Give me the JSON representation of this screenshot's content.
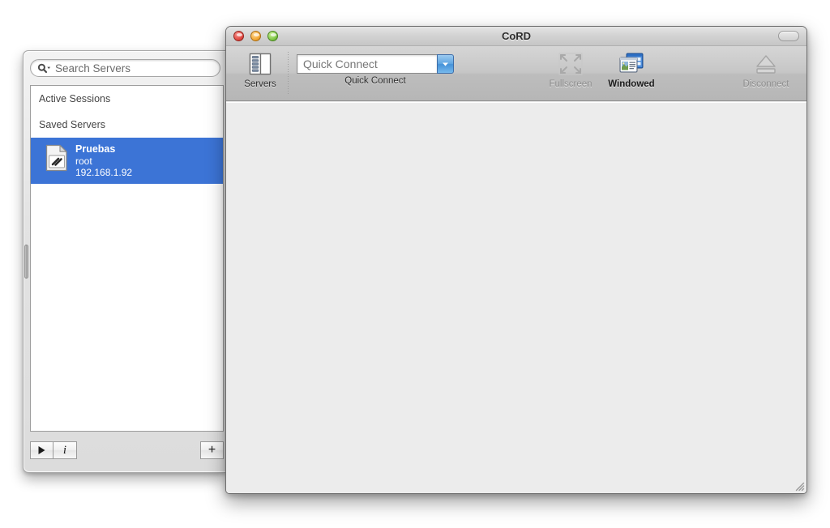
{
  "window": {
    "title": "CoRD",
    "traffic_lights": [
      "close",
      "minimize",
      "zoom"
    ],
    "toolbar_toggle_name": "toolbar-toggle-button"
  },
  "toolbar": {
    "servers": {
      "label": "Servers",
      "icon": "servers-drawer-icon",
      "enabled": true
    },
    "quick_connect": {
      "label": "Quick Connect",
      "placeholder": "Quick Connect",
      "value": "",
      "dropdown_icon": "chevron-down-icon"
    },
    "fullscreen": {
      "label": "Fullscreen",
      "icon": "fullscreen-arrows-icon",
      "enabled": false
    },
    "windowed": {
      "label": "Windowed",
      "icon": "windowed-stack-icon",
      "enabled": true,
      "selected": true
    },
    "disconnect": {
      "label": "Disconnect",
      "icon": "eject-icon",
      "enabled": false
    }
  },
  "drawer": {
    "search": {
      "placeholder": "Search Servers",
      "value": "",
      "icon": "search-icon"
    },
    "groups": [
      {
        "label": "Active Sessions",
        "items": []
      },
      {
        "label": "Saved Servers",
        "items": [
          {
            "name": "Pruebas",
            "username": "root",
            "host": "192.168.1.92",
            "icon": "rdp-document-icon",
            "selected": true
          }
        ]
      }
    ],
    "buttons": {
      "connect": {
        "label": "",
        "icon": "play-icon"
      },
      "info": {
        "label": "",
        "icon": "info-italic-icon"
      },
      "add": {
        "label": "",
        "icon": "plus-icon"
      }
    }
  },
  "colors": {
    "selection_blue": "#3c74d6",
    "content_background": "#ececec",
    "toolbar_top": "#d6d6d6",
    "toolbar_bottom": "#b6b6b6",
    "dropdown_blue": "#4592d8"
  }
}
